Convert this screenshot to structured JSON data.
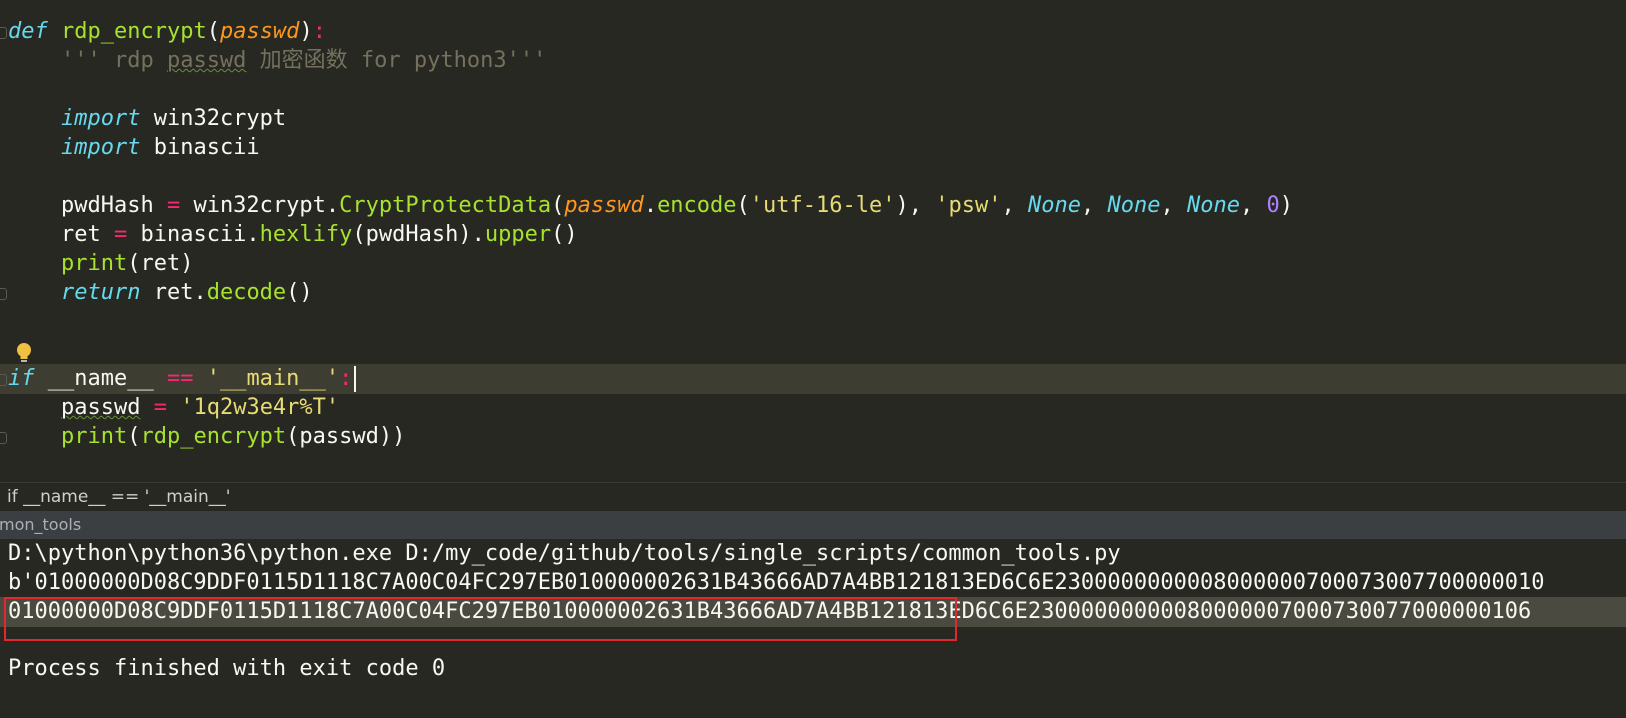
{
  "editor": {
    "lines": [
      {
        "id": "def",
        "tokens": [
          {
            "t": "def",
            "c": "kw"
          },
          {
            "t": " ",
            "c": ""
          },
          {
            "t": "rdp_encrypt",
            "c": "fn"
          },
          {
            "t": "(",
            "c": ""
          },
          {
            "t": "passwd",
            "c": "param"
          },
          {
            "t": ")",
            "c": ""
          },
          {
            "t": ":",
            "c": "op"
          }
        ]
      },
      {
        "id": "docstring",
        "tokens": [
          {
            "t": "    ",
            "c": ""
          },
          {
            "t": "''' rdp ",
            "c": "doc"
          },
          {
            "t": "passwd",
            "c": "doc squig"
          },
          {
            "t": " 加密函数 for python3'''",
            "c": "doc"
          }
        ]
      },
      {
        "id": "blank1",
        "tokens": []
      },
      {
        "id": "import1",
        "tokens": [
          {
            "t": "    ",
            "c": ""
          },
          {
            "t": "import",
            "c": "kw"
          },
          {
            "t": " win32crypt",
            "c": ""
          }
        ]
      },
      {
        "id": "import2",
        "tokens": [
          {
            "t": "    ",
            "c": ""
          },
          {
            "t": "import",
            "c": "kw"
          },
          {
            "t": " binascii",
            "c": ""
          }
        ]
      },
      {
        "id": "blank2",
        "tokens": []
      },
      {
        "id": "pwdhash",
        "tokens": [
          {
            "t": "    pwdHash ",
            "c": ""
          },
          {
            "t": "=",
            "c": "op"
          },
          {
            "t": " win32crypt.",
            "c": ""
          },
          {
            "t": "CryptProtectData",
            "c": "fn"
          },
          {
            "t": "(",
            "c": ""
          },
          {
            "t": "passwd",
            "c": "param"
          },
          {
            "t": ".",
            "c": ""
          },
          {
            "t": "encode",
            "c": "fn"
          },
          {
            "t": "(",
            "c": ""
          },
          {
            "t": "'utf-16-le'",
            "c": "str"
          },
          {
            "t": "), ",
            "c": ""
          },
          {
            "t": "'psw'",
            "c": "str"
          },
          {
            "t": ", ",
            "c": ""
          },
          {
            "t": "None",
            "c": "con"
          },
          {
            "t": ", ",
            "c": ""
          },
          {
            "t": "None",
            "c": "con"
          },
          {
            "t": ", ",
            "c": ""
          },
          {
            "t": "None",
            "c": "con"
          },
          {
            "t": ", ",
            "c": ""
          },
          {
            "t": "0",
            "c": "num"
          },
          {
            "t": ")",
            "c": ""
          }
        ]
      },
      {
        "id": "ret",
        "tokens": [
          {
            "t": "    ret ",
            "c": ""
          },
          {
            "t": "=",
            "c": "op"
          },
          {
            "t": " binascii.",
            "c": ""
          },
          {
            "t": "hexlify",
            "c": "fn"
          },
          {
            "t": "(pwdHash).",
            "c": ""
          },
          {
            "t": "upper",
            "c": "fn"
          },
          {
            "t": "()",
            "c": ""
          }
        ]
      },
      {
        "id": "print1",
        "tokens": [
          {
            "t": "    ",
            "c": ""
          },
          {
            "t": "print",
            "c": "fn"
          },
          {
            "t": "(ret)",
            "c": ""
          }
        ]
      },
      {
        "id": "return",
        "tokens": [
          {
            "t": "    ",
            "c": ""
          },
          {
            "t": "return",
            "c": "kw"
          },
          {
            "t": " ret.",
            "c": ""
          },
          {
            "t": "decode",
            "c": "fn"
          },
          {
            "t": "()",
            "c": ""
          }
        ]
      },
      {
        "id": "blank3",
        "tokens": []
      },
      {
        "id": "blank4",
        "tokens": []
      },
      {
        "id": "ifmain",
        "current": true,
        "tokens": [
          {
            "t": "if",
            "c": "kw"
          },
          {
            "t": " __name__ ",
            "c": ""
          },
          {
            "t": "==",
            "c": "op"
          },
          {
            "t": " ",
            "c": ""
          },
          {
            "t": "'__main__'",
            "c": "str"
          },
          {
            "t": ":",
            "c": "op"
          }
        ]
      },
      {
        "id": "passwd",
        "tokens": [
          {
            "t": "    ",
            "c": ""
          },
          {
            "t": "passwd",
            "c": "squig"
          },
          {
            "t": " ",
            "c": ""
          },
          {
            "t": "=",
            "c": "op"
          },
          {
            "t": " ",
            "c": ""
          },
          {
            "t": "'1q2w3e4r%T'",
            "c": "str"
          }
        ]
      },
      {
        "id": "print2",
        "tokens": [
          {
            "t": "    ",
            "c": ""
          },
          {
            "t": "print",
            "c": "fn"
          },
          {
            "t": "(",
            "c": ""
          },
          {
            "t": "rdp_encrypt",
            "c": "fn"
          },
          {
            "t": "(passwd))",
            "c": ""
          }
        ]
      }
    ]
  },
  "breadcrumb": {
    "text": "if __name__ == '__main__'"
  },
  "run_panel": {
    "tab_title": "mon_tools"
  },
  "console": {
    "command": "D:\\python\\python36\\python.exe D:/my_code/github/tools/single_scripts/common_tools.py",
    "bytes_output": "b'01000000D08C9DDF0115D1118C7A00C04FC297EB010000002631B43666AD7A4BB121813ED6C6E2300000000008000000700073007700000010",
    "decoded_output": "01000000D08C9DDF0115D1118C7A00C04FC297EB010000002631B43666AD7A4BB121813ED6C6E23000000000080000007000730077000000106",
    "exit_message": "Process finished with exit code 0"
  },
  "colors": {
    "background": "#272822",
    "current_line": "#3e3d32",
    "keyword": "#66d9ef",
    "function": "#a6e22e",
    "string": "#e6db74",
    "operator": "#f92672",
    "number": "#ae81ff",
    "highlight_box": "#e0282d"
  },
  "icons": [
    "lightbulb-icon",
    "fold-marker-icon"
  ]
}
